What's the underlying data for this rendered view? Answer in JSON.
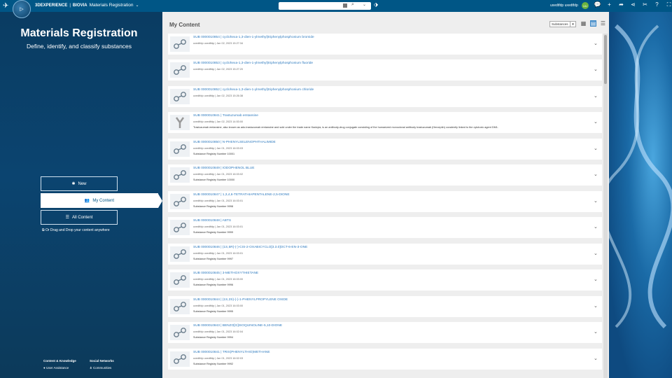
{
  "topbar": {
    "brand_platform": "3DEXPERIENCE",
    "brand_separator": "|",
    "brand_company": "BIOVIA",
    "app_name": "Materials Registration",
    "user_name": "uxedtfdp uxedtfdp",
    "avatar_initials": "UU"
  },
  "left": {
    "title": "Materials Registration",
    "subtitle": "Define, identify, and classify substances",
    "buttons": [
      {
        "label": "New",
        "icon": "asterisk-icon"
      },
      {
        "label": "My Content",
        "icon": "user-icon"
      },
      {
        "label": "All Content",
        "icon": "list-icon"
      }
    ],
    "drag_text": "Or Drag and Drop your content anywhere",
    "footer": {
      "col1_title": "Content & Knowledge",
      "col1_link": "User Assistance",
      "col2_title": "Social Networks",
      "col2_link": "Communities"
    }
  },
  "main": {
    "title": "My Content",
    "filter_value": "Substances",
    "items": [
      {
        "title": "SUB 0000010854 | cyclohexa-1,3-dien-1-ylmethyl)triphenylphosphonium bromide",
        "meta": "uxedtfdp uxedtfdp | Jan 02, 2023 15:27:34",
        "desc": "",
        "thumb": "molecule"
      },
      {
        "title": "SUB 0000010853 | cyclohexa-1,3-dien-1-ylmethyl)triphenylphosphonium fluoride",
        "meta": "uxedtfdp uxedtfdp | Jan 02, 2023 15:27:20",
        "desc": "",
        "thumb": "molecule"
      },
      {
        "title": "SUB 0000010852 | cyclohexa-1,3-dien-1-ylmethyl)triphenylphosphonium chloride",
        "meta": "uxedtfdp uxedtfdp | Jan 02, 2023 15:26:38",
        "desc": "",
        "thumb": "molecule"
      },
      {
        "title": "SUB 0000010841 | Trastuzumab emtansine",
        "meta": "uxedtfdp uxedtfdp | Jan 02, 2023 14:53:00",
        "desc": "Trastuzumab emtansine, also known as ado-trastuzumab emtansine and sold under the trade name Kadcyla, is an antibody-drug conjugate consisting of the humanized monoclonal antibody trastuzumab (Herceptin) covalently linked to the cytotoxic agent DM1.",
        "thumb": "antibody"
      },
      {
        "title": "SUB 0000010850 | N-PHENYLSELENOPHTHALIMIDE",
        "meta": "uxedtfdp uxedtfdp | Jan 01, 2023 16:03:03",
        "desc": "Substance Registry Number 10001",
        "thumb": "molecule"
      },
      {
        "title": "SUB 0000010849 | IODOPHENOL BLUE",
        "meta": "uxedtfdp uxedtfdp | Jan 01, 2023 16:03:02",
        "desc": "Substance Registry Number 10000",
        "thumb": "molecule"
      },
      {
        "title": "SUB 0000010847 | 1,3,4,6-TETRATHIAPENTALENE-2,5-DIONE",
        "meta": "uxedtfdp uxedtfdp | Jan 01, 2023 16:03:01",
        "desc": "Substance Registry Number 9998",
        "thumb": "molecule"
      },
      {
        "title": "SUB 0000010848 | ABTS",
        "meta": "uxedtfdp uxedtfdp | Jan 01, 2023 16:03:01",
        "desc": "Substance Registry Number 9999",
        "thumb": "molecule"
      },
      {
        "title": "SUB 0000010846 | (1S,5R)-(-)-CIS-2-OXABICYCLO[3.3.0]OCT-6-EN-3-ONE",
        "meta": "uxedtfdp uxedtfdp | Jan 01, 2023 16:03:01",
        "desc": "Substance Registry Number 9997",
        "thumb": "molecule"
      },
      {
        "title": "SUB 0000010845 | 3-METHOXYTHIETANE",
        "meta": "uxedtfdp uxedtfdp | Jan 01, 2023 16:03:00",
        "desc": "Substance Registry Number 9996",
        "thumb": "molecule"
      },
      {
        "title": "SUB 0000010844 | (1S,2S)-(-)-1-PHENYLPROPYLENE OXIDE",
        "meta": "uxedtfdp uxedtfdp | Jan 01, 2023 16:03:00",
        "desc": "Substance Registry Number 9995",
        "thumb": "molecule"
      },
      {
        "title": "SUB 0000010843 | BENZO[G]ISOQUINOLINE-5,10-DIONE",
        "meta": "uxedtfdp uxedtfdp | Jan 01, 2023 16:02:04",
        "desc": "Substance Registry Number 9994",
        "thumb": "molecule"
      },
      {
        "title": "SUB 0000010841 | TRIS(PHENYLTHIO)METHANE",
        "meta": "uxedtfdp uxedtfdp | Jan 01, 2023 16:02:03",
        "desc": "Substance Registry Number 9992",
        "thumb": "molecule"
      }
    ]
  },
  "colors": {
    "topbar": "#005686",
    "link": "#2f7bbf",
    "active_button_text": "#005686"
  }
}
